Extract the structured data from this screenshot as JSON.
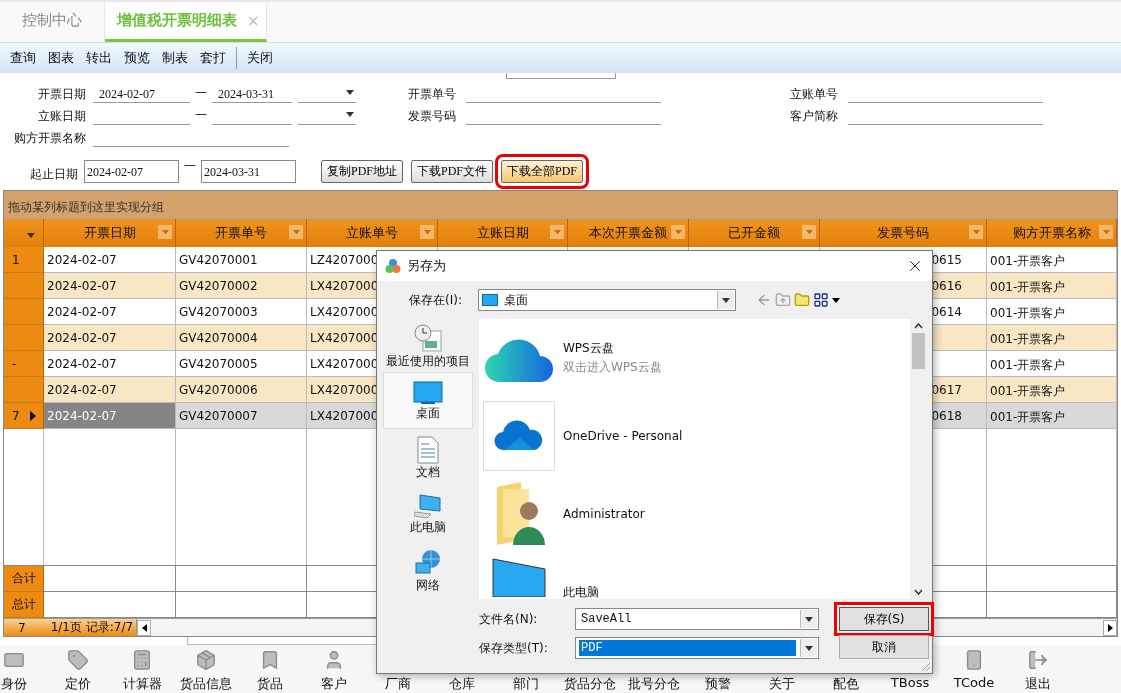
{
  "tabs": [
    {
      "label": "控制中心",
      "selected": false
    },
    {
      "label": "增值税开票明细表",
      "selected": true,
      "close": "×"
    }
  ],
  "toolbar": {
    "items": [
      "查询",
      "图表",
      "转出",
      "预览",
      "制表",
      "套打"
    ],
    "trailing": [
      "关闭"
    ]
  },
  "filters": {
    "invoice_date": {
      "label": "开票日期",
      "from": "2024-02-07",
      "sep": "—",
      "to": "2024-03-31"
    },
    "posting_date": {
      "label": "立账日期",
      "sep": "—"
    },
    "buyer_name": {
      "label": "购方开票名称"
    },
    "invoice_no": {
      "label": "开票单号"
    },
    "tax_invoice_no": {
      "label": "发票号码"
    },
    "posting_no": {
      "label": "立账单号"
    },
    "customer": {
      "label": "客户简称"
    },
    "range": {
      "label": "起止日期",
      "from": "2024-02-07",
      "sep": "—",
      "to": "2024-03-31"
    },
    "actions": [
      {
        "label": "复制PDF地址",
        "highlighted": false
      },
      {
        "label": "下载PDF文件",
        "highlighted": false
      },
      {
        "label": "下载全部PDF",
        "highlighted": true
      }
    ]
  },
  "grid": {
    "group_hint": "拖动某列标题到这里实现分组",
    "columns": [
      "开票日期",
      "开票单号",
      "立账单号",
      "立账日期",
      "本次开票金额",
      "已开金额",
      "发票号码",
      "购方开票名称"
    ],
    "rows": [
      {
        "marker": "1",
        "current": false,
        "cells": [
          "2024-02-07",
          "GV42070001",
          "LZ4207000",
          "",
          "",
          "",
          "0615",
          "001-开票客户"
        ]
      },
      {
        "current": false,
        "cells": [
          "2024-02-07",
          "GV42070002",
          "LX4207000",
          "",
          "",
          "",
          "0616",
          "001-开票客户"
        ]
      },
      {
        "current": false,
        "cells": [
          "2024-02-07",
          "GV42070003",
          "LX4207000",
          "",
          "",
          "",
          "0614",
          "001-开票客户"
        ]
      },
      {
        "current": false,
        "cells": [
          "2024-02-07",
          "GV42070004",
          "LX4207000",
          "",
          "",
          "",
          "",
          "001-开票客户"
        ]
      },
      {
        "marker": "-",
        "current": false,
        "cells": [
          "2024-02-07",
          "GV42070005",
          "LX4207000",
          "",
          "",
          "",
          "",
          "001-开票客户"
        ]
      },
      {
        "current": false,
        "cells": [
          "2024-02-07",
          "GV42070006",
          "LX4207000",
          "",
          "",
          "",
          "0617",
          "001-开票客户"
        ]
      },
      {
        "marker": "7",
        "current": true,
        "cells": [
          "2024-02-07",
          "GV42070007",
          "LX4207000",
          "",
          "",
          "",
          "0618",
          "001-开票客户"
        ]
      }
    ],
    "totals": [
      "合计",
      "总计"
    ],
    "pager": {
      "current": "7",
      "summary": "1/1页 记录:7/7"
    }
  },
  "dock": [
    {
      "label": "身份",
      "kind": "id"
    },
    {
      "label": "定价",
      "kind": "tag"
    },
    {
      "label": "计算器",
      "kind": "calculator"
    },
    {
      "label": "货品信息",
      "kind": "package"
    },
    {
      "label": "货品",
      "kind": "book"
    },
    {
      "label": "客户",
      "kind": "person"
    },
    {
      "label": "厂商",
      "kind": "factory"
    },
    {
      "label": "仓库",
      "kind": "warehouse"
    },
    {
      "label": "部门",
      "kind": "network"
    },
    {
      "label": "货品分仓",
      "kind": "boxes"
    },
    {
      "label": "批号分仓",
      "kind": "layers"
    },
    {
      "label": "预警",
      "kind": "alert"
    },
    {
      "label": "关于",
      "kind": "info"
    },
    {
      "label": "配色",
      "kind": "palette"
    },
    {
      "label": "TBoss",
      "kind": "crown"
    },
    {
      "label": "TCode",
      "kind": "phone"
    },
    {
      "label": "退出",
      "kind": "exit"
    }
  ],
  "dialog": {
    "title": "另存为",
    "save_in": {
      "label": "保存在(I):",
      "value": "桌面"
    },
    "places": [
      {
        "label": "最近使用的项目",
        "kind": "recent",
        "selected": false
      },
      {
        "label": "桌面",
        "kind": "desktop",
        "selected": true
      },
      {
        "label": "文档",
        "kind": "documents",
        "selected": false
      },
      {
        "label": "此电脑",
        "kind": "computer",
        "selected": false
      },
      {
        "label": "网络",
        "kind": "network",
        "selected": false
      }
    ],
    "files": [
      {
        "name": "WPS云盘",
        "subtitle": "双击进入WPS云盘",
        "kind": "wps"
      },
      {
        "name": "OneDrive - Personal",
        "kind": "onedrive"
      },
      {
        "name": "Administrator",
        "kind": "user"
      },
      {
        "name": "此电脑",
        "kind": "computer"
      }
    ],
    "file_name": {
      "label": "文件名(N):",
      "value": "SaveAll"
    },
    "file_type": {
      "label": "保存类型(T):",
      "value": "PDF"
    },
    "buttons": [
      {
        "label": "保存(S)",
        "highlighted": true
      },
      {
        "label": "取消",
        "highlighted": false
      }
    ]
  }
}
